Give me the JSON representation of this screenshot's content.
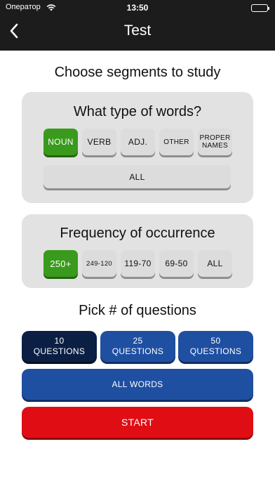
{
  "status_bar": {
    "carrier": "Оператор",
    "time": "13:50"
  },
  "nav": {
    "title": "Test"
  },
  "main": {
    "heading": "Choose segments to study",
    "word_types": {
      "title": "What type of words?",
      "options": [
        {
          "label": "NOUN",
          "selected": true
        },
        {
          "label": "VERB",
          "selected": false
        },
        {
          "label": "ADJ.",
          "selected": false
        },
        {
          "label": "OTHER",
          "selected": false
        },
        {
          "label": "PROPER NAMES",
          "selected": false
        }
      ],
      "all_label": "ALL"
    },
    "frequency": {
      "title": "Frequency of occurrence",
      "options": [
        {
          "label": "250+",
          "selected": true
        },
        {
          "label": "249-120",
          "selected": false
        },
        {
          "label": "119-70",
          "selected": false
        },
        {
          "label": "69-50",
          "selected": false
        },
        {
          "label": "ALL",
          "selected": false
        }
      ]
    },
    "questions": {
      "title": "Pick # of questions",
      "options": [
        {
          "count": "10",
          "unit": "QUESTIONS",
          "selected": true
        },
        {
          "count": "25",
          "unit": "QUESTIONS",
          "selected": false
        },
        {
          "count": "50",
          "unit": "QUESTIONS",
          "selected": false
        }
      ],
      "all_words_label": "ALL WORDS"
    },
    "start_label": "START"
  },
  "colors": {
    "header": "#1c1c1c",
    "selected_green": "#3a9a1d",
    "button_blue": "#1f4fa0",
    "button_selected_navy": "#0b1f44",
    "start_red": "#e10d14",
    "card_gray": "#e2e2e2"
  },
  "icons": {
    "back": "chevron-left-icon",
    "wifi": "wifi-icon",
    "battery": "battery-icon"
  }
}
